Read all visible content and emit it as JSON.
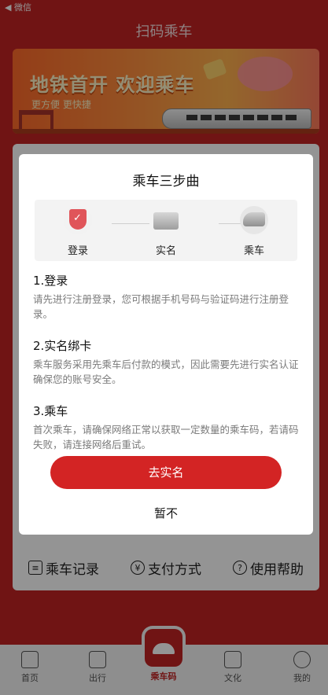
{
  "statusbar": {
    "back_label": "◀ 微信"
  },
  "header": {
    "title": "扫码乘车"
  },
  "banner": {
    "headline": "地铁首开  欢迎乘车",
    "tagline": "更方便  更快捷"
  },
  "card_links": [
    {
      "icon": "list-icon",
      "label": "乘车记录"
    },
    {
      "icon": "yen-icon",
      "label": "支付方式"
    },
    {
      "icon": "help-icon",
      "label": "使用帮助"
    }
  ],
  "tabbar": {
    "items": [
      {
        "icon": "home-icon",
        "label": "首页"
      },
      {
        "icon": "map-icon",
        "label": "出行"
      },
      {
        "icon": "ride-code-icon",
        "label": "乘车码"
      },
      {
        "icon": "culture-icon",
        "label": "文化"
      },
      {
        "icon": "profile-icon",
        "label": "我的"
      }
    ]
  },
  "modal": {
    "title": "乘车三步曲",
    "steps": [
      {
        "icon": "shield-check-icon",
        "label": "登录"
      },
      {
        "icon": "card-icon",
        "label": "实名"
      },
      {
        "icon": "train-icon",
        "label": "乘车"
      }
    ],
    "sections": [
      {
        "heading": "1.登录",
        "body": "请先进行注册登录，您可根据手机号码与验证码进行注册登录。"
      },
      {
        "heading": "2.实名绑卡",
        "body": "乘车服务采用先乘车后付款的模式，因此需要先进行实名认证确保您的账号安全。"
      },
      {
        "heading": "3.乘车",
        "body": "首次乘车，请确保网络正常以获取一定数量的乘车码，若请码失败，请连接网络后重试。"
      }
    ],
    "primary_button": "去实名",
    "secondary_button": "暂不"
  },
  "colors": {
    "brand_red": "#c22323",
    "button_red": "#d32424"
  }
}
